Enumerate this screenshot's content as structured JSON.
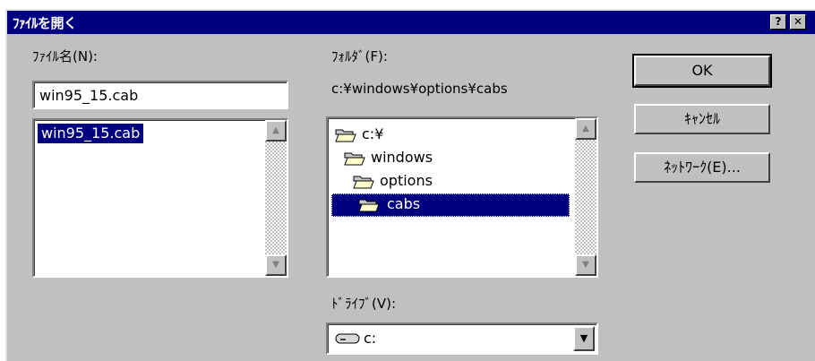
{
  "titlebar": {
    "title": "ﾌｧｲﾙを開く",
    "help_glyph": "?",
    "close_glyph": "✕"
  },
  "filename": {
    "label": "ﾌｧｲﾙ名(N):",
    "value": "win95_15.cab"
  },
  "file_list": {
    "items": [
      {
        "label": "win95_15.cab",
        "selected": true
      }
    ]
  },
  "folder": {
    "label": "ﾌｫﾙﾀﾞ(F):",
    "path": "c:¥windows¥options¥cabs"
  },
  "folder_tree": {
    "items": [
      {
        "label": "c:¥",
        "selected": false,
        "icon": "open-folder-icon"
      },
      {
        "label": "windows",
        "selected": false,
        "icon": "open-folder-icon"
      },
      {
        "label": "options",
        "selected": false,
        "icon": "open-folder-icon"
      },
      {
        "label": "cabs",
        "selected": true,
        "icon": "open-folder-icon"
      }
    ]
  },
  "drive": {
    "label": "ﾄﾞﾗｲﾌﾞ(V):",
    "value": "c:",
    "icon": "drive-icon"
  },
  "buttons": {
    "ok": "OK",
    "cancel": "ｷｬﾝｾﾙ",
    "network": "ﾈｯﾄﾜｰｸ(E)..."
  },
  "colors": {
    "face": "#c0c0c0",
    "title_bg": "#000080",
    "selection": "#000080"
  }
}
